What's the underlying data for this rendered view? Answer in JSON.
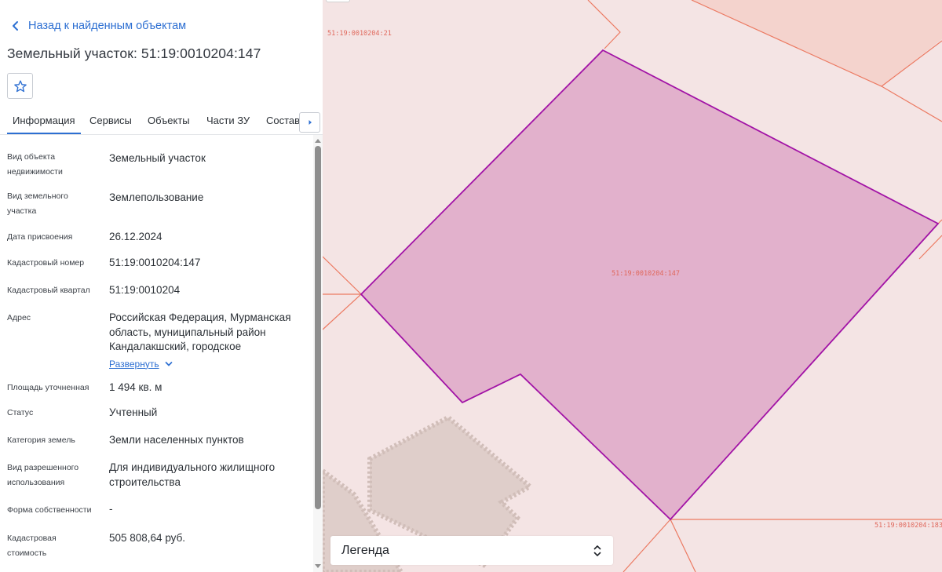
{
  "header": {
    "back_label": "Назад к найденным объектам",
    "title": "Земельный участок: 51:19:0010204:147"
  },
  "tabs": [
    {
      "label": "Информация",
      "active": true
    },
    {
      "label": "Сервисы"
    },
    {
      "label": "Объекты"
    },
    {
      "label": "Части ЗУ"
    },
    {
      "label": "Состав"
    }
  ],
  "properties": [
    {
      "label": "Вид объекта недвижимости",
      "value": "Земельный участок"
    },
    {
      "label": "Вид земельного участка",
      "value": "Землепользование"
    },
    {
      "label": "Дата присвоения",
      "value": "26.12.2024"
    },
    {
      "label": "Кадастровый номер",
      "value": "51:19:0010204:147"
    },
    {
      "label": "Кадастровый квартал",
      "value": "51:19:0010204"
    },
    {
      "label": "Адрес",
      "value": "Российская Федерация, Мурманская область, муниципальный район Кандалакшский, городское",
      "expand_label": "Развернуть"
    },
    {
      "label": "Площадь уточненная",
      "value": "1 494 кв. м"
    },
    {
      "label": "Статус",
      "value": "Учтенный"
    },
    {
      "label": "Категория земель",
      "value": "Земли населенных пунктов"
    },
    {
      "label": "Вид разрешенного использования",
      "value": "Для индивидуального жилищного строительства"
    },
    {
      "label": "Форма собственности",
      "value": "-"
    },
    {
      "label": "Кадастровая стоимость",
      "value": "505 808,64 руб."
    }
  ],
  "map": {
    "labels": {
      "parcel_21": "51:19:0010204:21",
      "parcel_147": "51:19:0010204:147",
      "parcel_183": "51:19:0010204:183"
    },
    "legend_label": "Легенда",
    "colors": {
      "background": "#f4e4e4",
      "selected_fill": "#e2b1cc",
      "selected_stroke": "#a213a6",
      "boundary": "#ec7a62",
      "building": "#dccbc6"
    }
  },
  "colors": {
    "accent": "#2d6fd2"
  }
}
